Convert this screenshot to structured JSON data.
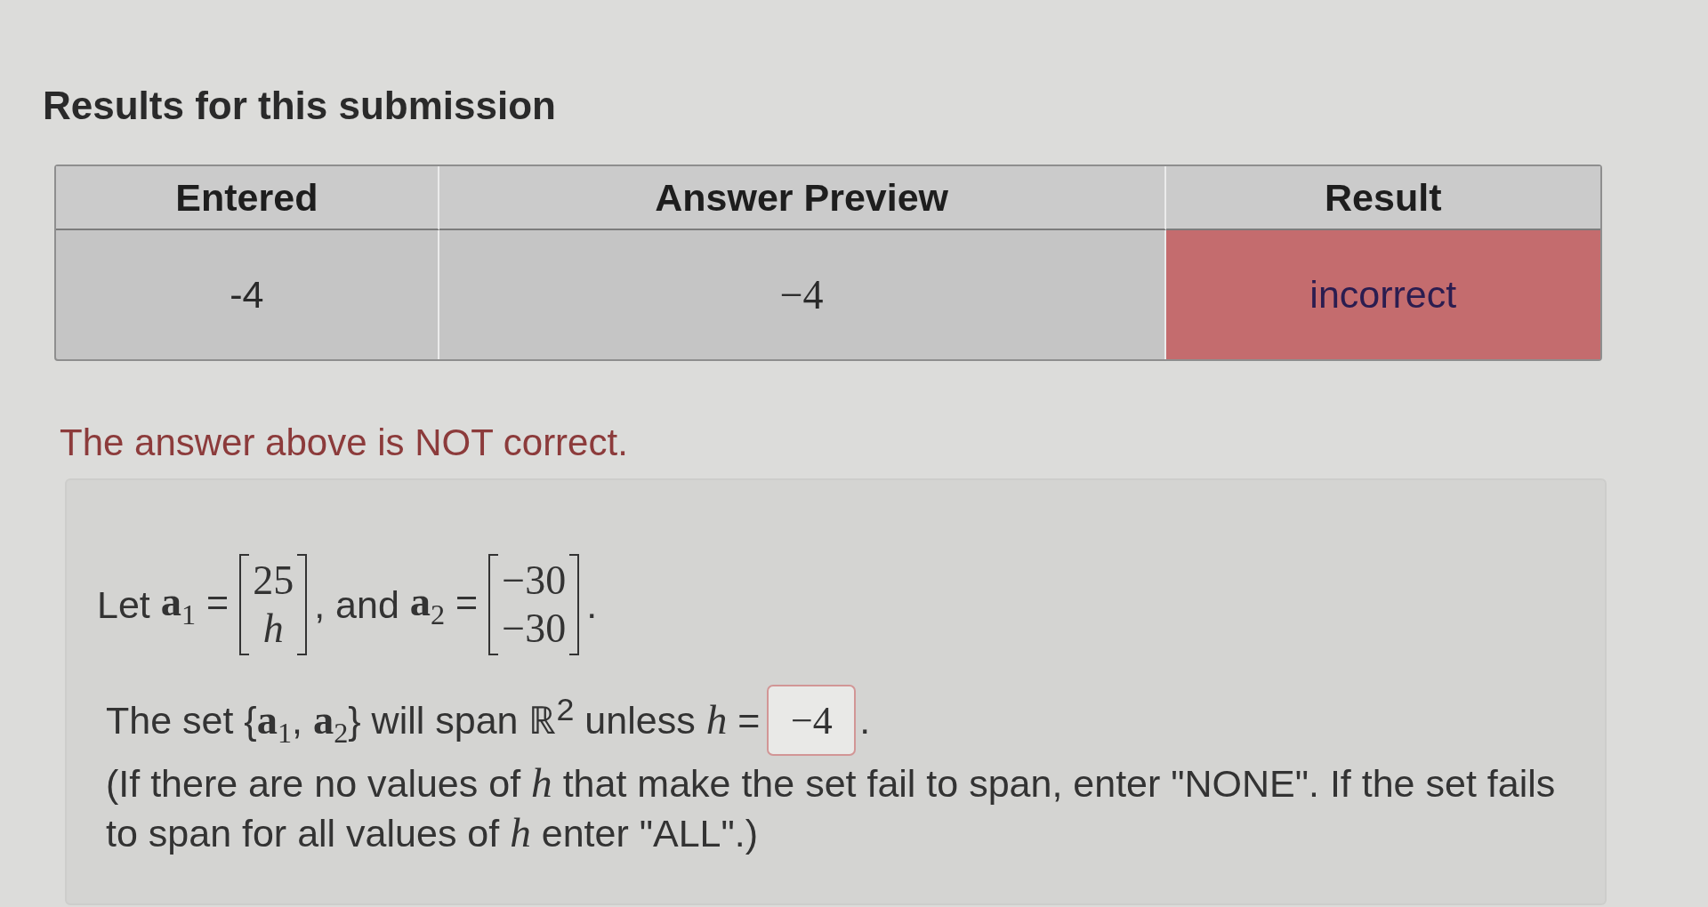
{
  "heading": "Results for this submission",
  "results_table": {
    "columns": [
      "Entered",
      "Answer Preview",
      "Result"
    ],
    "rows": [
      {
        "entered": "-4",
        "answer_preview": "−4",
        "result": "incorrect",
        "correct": false
      }
    ]
  },
  "feedback": {
    "text": "The answer above is NOT correct.",
    "correct": false
  },
  "problem": {
    "definition": [
      {
        "kind": "text",
        "text": "Let"
      },
      {
        "kind": "math",
        "text": "**a**$_{1}$ ="
      },
      {
        "kind": "matrix",
        "entries": [
          {
            "kind": "number",
            "text": "25"
          },
          {
            "kind": "variable",
            "text": "h"
          }
        ]
      },
      {
        "kind": "text",
        "text": ", and"
      },
      {
        "kind": "math",
        "text": "**a**$_{2}$ ="
      },
      {
        "kind": "matrix",
        "entries": [
          {
            "kind": "number",
            "text": "−30"
          },
          {
            "kind": "number",
            "text": "−30"
          }
        ]
      },
      {
        "kind": "text",
        "text": "."
      }
    ],
    "question": {
      "text": "The set {**a**$_{1}$, **a**$_{2}$} will span ℝ$^{2}$ unless *h* =",
      "answer": {
        "value": "−4",
        "correct": false
      },
      "end": "."
    },
    "instructions": "(If there are no values of *h* that make the set fail to span, enter \"NONE\". If the set fails to span for all values of *h* enter \"ALL\".)"
  }
}
